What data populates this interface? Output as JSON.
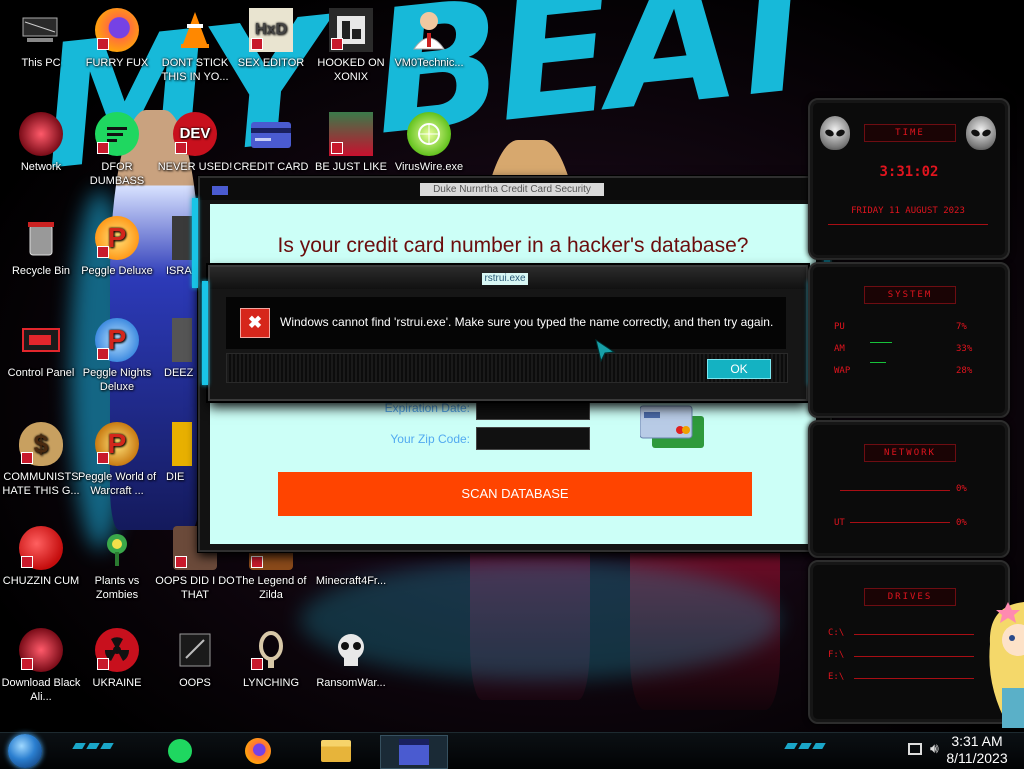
{
  "desktop": {
    "icons": [
      {
        "id": "this-pc",
        "label": "This PC"
      },
      {
        "id": "furry-fux",
        "label": "FURRY FUX"
      },
      {
        "id": "dont-stick",
        "label": "DONT STICK THIS IN YO..."
      },
      {
        "id": "sex-editor",
        "label": "SEX EDITOR"
      },
      {
        "id": "hooked-on-xonix",
        "label": "HOOKED ON XONIX"
      },
      {
        "id": "vm0technic",
        "label": "VM0Technic..."
      },
      {
        "id": "network",
        "label": "Network"
      },
      {
        "id": "dfor-dumbass",
        "label": "DFOR DUMBASS"
      },
      {
        "id": "never-used",
        "label": "NEVER USED!"
      },
      {
        "id": "credit-card",
        "label": "CREDIT CARD"
      },
      {
        "id": "be-just-like",
        "label": "BE JUST LIKE"
      },
      {
        "id": "viruswire",
        "label": "VirusWire.exe"
      },
      {
        "id": "recycle-bin",
        "label": "Recycle Bin"
      },
      {
        "id": "peggle-deluxe",
        "label": "Peggle Deluxe"
      },
      {
        "id": "isra",
        "label": "ISRA"
      },
      {
        "id": "control-panel",
        "label": "Control Panel"
      },
      {
        "id": "peggle-nights",
        "label": "Peggle Nights Deluxe"
      },
      {
        "id": "deez",
        "label": "DEEZ"
      },
      {
        "id": "communists",
        "label": "COMMUNISTS HATE THIS G..."
      },
      {
        "id": "peggle-world",
        "label": "Peggle World of Warcraft ..."
      },
      {
        "id": "die",
        "label": "DIE"
      },
      {
        "id": "chuzzin-cum",
        "label": "CHUZZIN CUM"
      },
      {
        "id": "plants-vs-zombies",
        "label": "Plants vs Zombies"
      },
      {
        "id": "oops-did-i",
        "label": "OOPS DID I DO THAT"
      },
      {
        "id": "legend-of-zilda",
        "label": "The Legend of Zilda"
      },
      {
        "id": "minecraft4fr",
        "label": "Minecraft4Fr..."
      },
      {
        "id": "download-black-ali",
        "label": "Download Black Ali..."
      },
      {
        "id": "ukraine",
        "label": "UKRAINE"
      },
      {
        "id": "oops",
        "label": "OOPS"
      },
      {
        "id": "lynching",
        "label": "LYNCHING"
      },
      {
        "id": "ransomwar",
        "label": "RansomWar..."
      }
    ]
  },
  "background_window": {
    "title": "Duke Nurnrtha Credit Card Security",
    "headline": "Is your credit card number in a hacker's database?",
    "fields": {
      "expiration_label": "Expiration Date:",
      "zip_label": "Your Zip Code:"
    },
    "scan_button": "SCAN DATABASE"
  },
  "error_dialog": {
    "title": "rstrui.exe",
    "message": "Windows cannot find 'rstrui.exe'. Make sure you typed the name correctly, and then try again.",
    "icon": "error-x-icon",
    "ok_label": "OK"
  },
  "gadgets": {
    "time": {
      "header": "TIME",
      "clock": "3:31:02",
      "date": "FRIDAY 11 AUGUST 2023"
    },
    "system": {
      "header": "SYSTEM",
      "rows": [
        {
          "label": "PU",
          "value": "7%"
        },
        {
          "label": "AM",
          "value": "33%"
        },
        {
          "label": "WAP",
          "value": "28%"
        }
      ]
    },
    "network": {
      "header": "NETWORK",
      "rows": [
        {
          "label": "",
          "value": "0%"
        },
        {
          "label": "UT",
          "value": "0%"
        }
      ]
    },
    "drives": {
      "header": "DRIVES",
      "rows": [
        {
          "label": "C:\\"
        },
        {
          "label": "F:\\"
        },
        {
          "label": "E:\\"
        }
      ]
    }
  },
  "taskbar": {
    "apps": [
      "green-chat-icon",
      "firefox-icon",
      "file-explorer-icon",
      "credit-card-app-icon"
    ],
    "clock_time": "3:31 AM",
    "clock_date": "8/11/2023"
  },
  "colors": {
    "accent_cyan": "#19c4e6",
    "gadget_red": "#e0141e",
    "scan_button": "#ff4400",
    "headline": "#6b0d0d",
    "dialog_bg": "#ccfff7"
  }
}
